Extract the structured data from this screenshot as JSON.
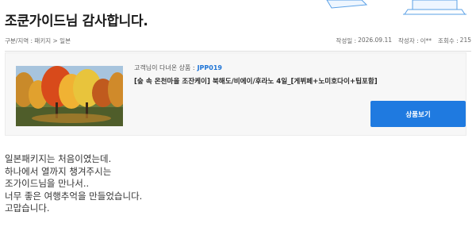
{
  "review": {
    "title": "조쿤가이드님 감사합니다.",
    "breadcrumb": "구분/지역 : 패키지 > 일본",
    "meta": {
      "date_label": "작성일 :",
      "date_value": "2026.09.11",
      "author_label": "작성자 :",
      "author_value": "이**",
      "views_label": "조회수 :",
      "views_value": "215"
    },
    "body_lines": [
      "일본패키지는 처음이였는데.",
      "하나에서 열까지 챙겨주시는",
      "조가이드님을 만나서..",
      "너무 좋은 여행추억을 만들었습니다.",
      "고맙습니다."
    ]
  },
  "product": {
    "code_label": "고객님이 다녀온 상품 :",
    "code_value": "JPP019",
    "name": "[숲 속 온천마을 조잔케이] 북해도/비에이/후라노 4일_[게뷔페+노미호다이+팁포함]",
    "thumb_icon": "autumn-trees-photo",
    "button_label": "상품보기"
  },
  "colors": {
    "accent": "#1f7ae0",
    "code": "#1e74d6"
  }
}
